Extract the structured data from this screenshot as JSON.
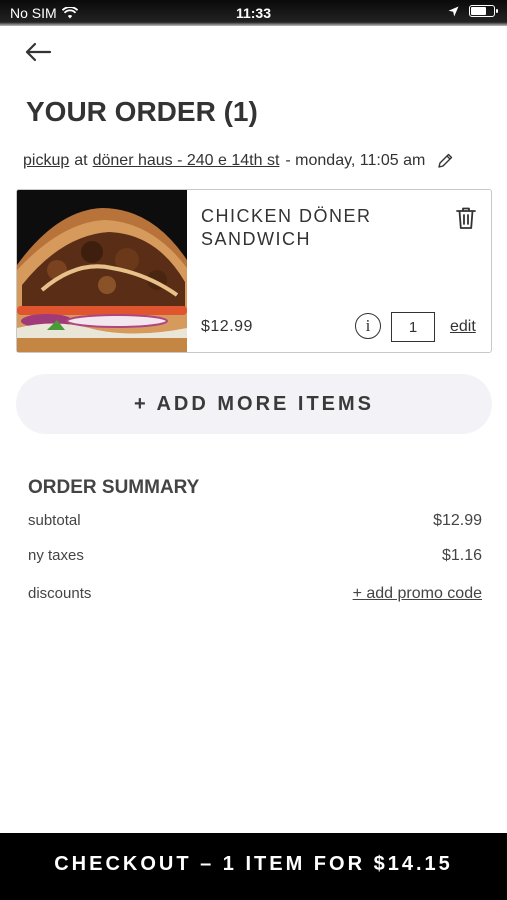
{
  "status_bar": {
    "carrier": "No SIM",
    "time": "11:33",
    "battery_level": 0.7
  },
  "header": {
    "back_icon": "arrow-left-icon",
    "title": "YOUR ORDER (1)"
  },
  "order_meta": {
    "mode": "pickup",
    "connector": "at",
    "location": "döner haus - 240 e 14th st",
    "time": "- monday, 11:05 am",
    "edit_icon": "pencil-icon"
  },
  "item": {
    "name": "CHICKEN DÖNER SANDWICH",
    "price": "$12.99",
    "quantity": "1",
    "info_icon": "info-icon",
    "info_glyph": "i",
    "edit_label": "edit",
    "delete_icon": "trash-icon"
  },
  "add_more_label": "+ ADD MORE ITEMS",
  "summary": {
    "title": "ORDER SUMMARY",
    "rows": [
      {
        "label": "subtotal",
        "value": "$12.99"
      },
      {
        "label": "ny taxes",
        "value": "$1.16"
      },
      {
        "label": "discounts",
        "value": "+ add promo code"
      }
    ]
  },
  "checkout_label": "CHECKOUT – 1 ITEM FOR $14.15",
  "colors": {
    "primary_text": "#333333",
    "add_more_bg": "#f3f3f7",
    "checkout_bg": "#000000",
    "card_border": "#c9c9c9"
  }
}
